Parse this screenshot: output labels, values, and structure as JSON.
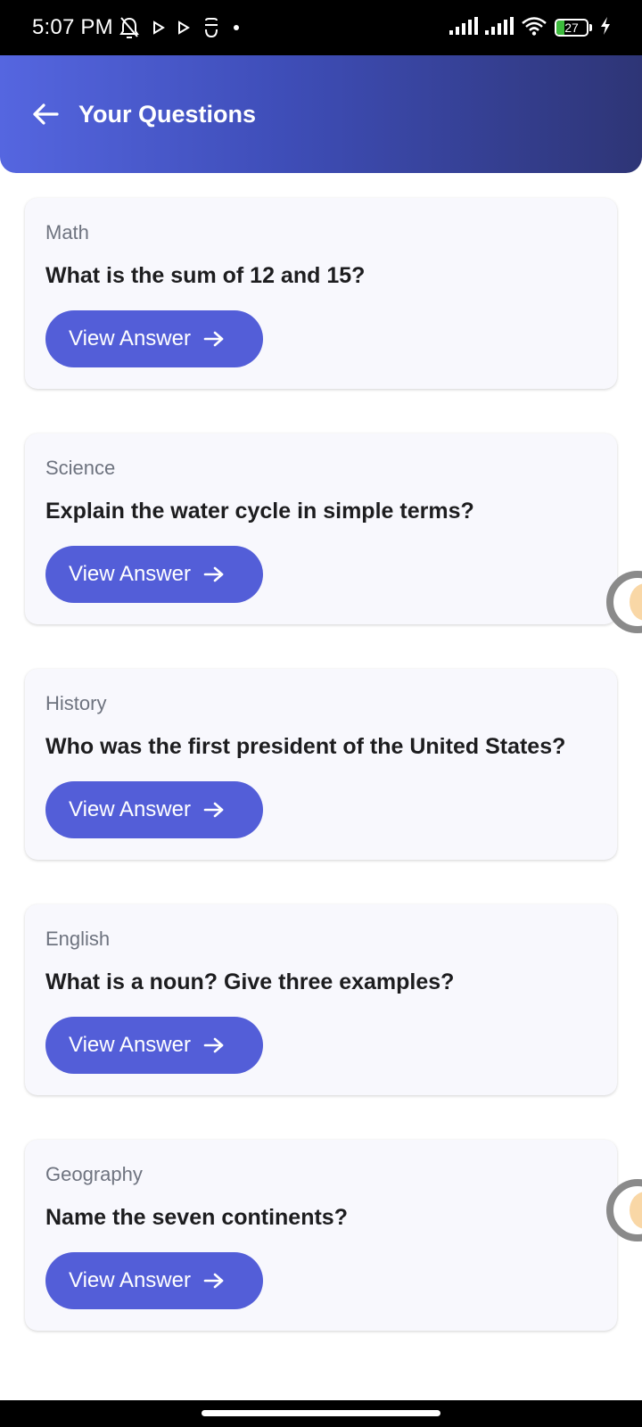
{
  "status_bar": {
    "time": "5:07 PM",
    "battery_level": "27",
    "battery_color": "#3dbb3d",
    "icons": [
      "alarm-off-icon",
      "play-icon",
      "play-icon",
      "sim-icon",
      "dot-icon",
      "signal-icon",
      "signal-icon",
      "wifi-icon",
      "battery-icon",
      "charging-icon"
    ]
  },
  "header": {
    "title": "Your Questions",
    "gradient_start": "#5566e0",
    "gradient_end": "#2e3576"
  },
  "questions": [
    {
      "subject": "Math",
      "question": "What is the sum of 12 and 15?",
      "button_label": "View Answer"
    },
    {
      "subject": "Science",
      "question": "Explain the water cycle in simple terms?",
      "button_label": "View Answer"
    },
    {
      "subject": "History",
      "question": "Who was the first president of the United States?",
      "button_label": "View Answer"
    },
    {
      "subject": "English",
      "question": "What is a noun? Give three examples?",
      "button_label": "View Answer"
    },
    {
      "subject": "Geography",
      "question": "Name the seven continents?",
      "button_label": "View Answer"
    }
  ],
  "colors": {
    "button": "#535ed8",
    "card_background": "#f8f8fd",
    "subject_text": "#6e737f"
  }
}
